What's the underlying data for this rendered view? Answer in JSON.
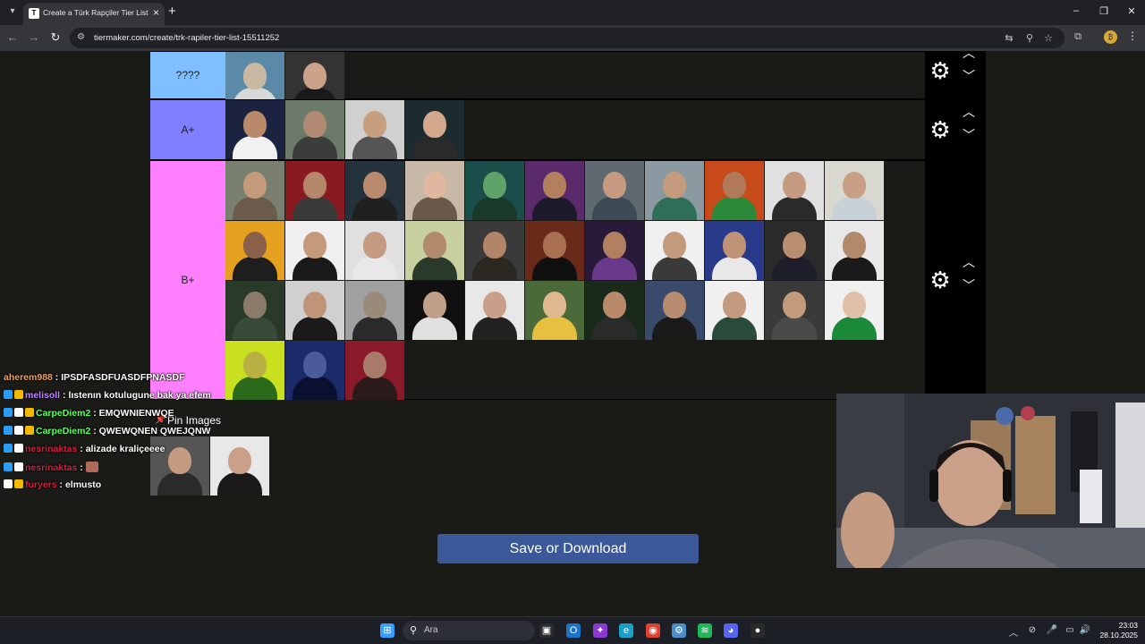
{
  "browser": {
    "tab_title": "Create a Türk Rapçiler Tier List",
    "url": "tiermaker.com/create/trk-rapiler-tier-list-15511252",
    "new_tab_label": "+",
    "close_tab_label": "×"
  },
  "tiers": [
    {
      "label": "????",
      "color": "#80bfff",
      "thumbs": [
        [
          "#5a8aa8",
          "#c9b9a2",
          "#d8d8d8"
        ],
        [
          "#333",
          "#caa28a",
          "#1a1a1a"
        ]
      ]
    },
    {
      "label": "A+",
      "color": "#7f7fff",
      "thumbs": [
        [
          "#1b2340",
          "#b88a6a",
          "#f1f1f1"
        ],
        [
          "#6c7a6a",
          "#b08a72",
          "#3a3d3a"
        ],
        [
          "#d0d0d0",
          "#c6a07e",
          "#555"
        ],
        [
          "#1c2b30",
          "#d4a88c",
          "#2a2a2a"
        ]
      ]
    },
    {
      "label": "B+",
      "color": "#ff7fff",
      "thumbs": [
        [
          "#7a8070",
          "#c39a7a",
          "#6b5b4a"
        ],
        [
          "#8a1a22",
          "#b4876a",
          "#3a3a3a"
        ],
        [
          "#24323c",
          "#b98a6e",
          "#202020"
        ],
        [
          "#c8b8a8",
          "#e0b8a0",
          "#6a5a4a"
        ],
        [
          "#1b4d4a",
          "#5fa36a",
          "#1a3a2a"
        ],
        [
          "#5a2a6a",
          "#b2805e",
          "#1c1a2a"
        ],
        [
          "#5e6a70",
          "#c59a80",
          "#3b4a55"
        ],
        [
          "#8a9aa0",
          "#c49a7c",
          "#2f6f5a"
        ],
        [
          "#c74a1a",
          "#b07a5a",
          "#2a8a3a"
        ],
        [
          "#e0e0e0",
          "#c49a80",
          "#2a2a2a"
        ],
        [
          "#d8d8d0",
          "#c9a085",
          "#c8d0d8"
        ],
        [
          "#e6a020",
          "#8a6048",
          "#1e1e1e"
        ],
        [
          "#f0f0f0",
          "#c49a7a",
          "#1a1a1a"
        ],
        [
          "#e0e0e0",
          "#c59a82",
          "#e8e8e8"
        ],
        [
          "#c8d0a0",
          "#b08a6a",
          "#2a3a2a"
        ],
        [
          "#3a3a3a",
          "#b28468",
          "#2a2820"
        ],
        [
          "#6a2a1a",
          "#a87050",
          "#101010"
        ],
        [
          "#2a1a3a",
          "#b08060",
          "#6a3a8a"
        ],
        [
          "#f0f0f0",
          "#c49a7c",
          "#3a3a3a"
        ],
        [
          "#2a3a8a",
          "#c09276",
          "#e8e8e8"
        ],
        [
          "#2a2a2a",
          "#b98e70",
          "#1e1e2a"
        ],
        [
          "#e8e8e8",
          "#b08a6a",
          "#1a1a1a"
        ],
        [
          "#2a3a2a",
          "#8a7a6a",
          "#3a4a3a"
        ],
        [
          "#d0d0d0",
          "#c09478",
          "#1a1a1a"
        ],
        [
          "#a0a0a0",
          "#9a8a7a",
          "#2a2a2a"
        ],
        [
          "#101010",
          "#c0a088",
          "#e0e0e0"
        ],
        [
          "#e8e8e8",
          "#c8a08a",
          "#222"
        ],
        [
          "#4a6a3a",
          "#e0b890",
          "#e8c040"
        ],
        [
          "#1a2a1a",
          "#b88a6a",
          "#2a2a2a"
        ],
        [
          "#3a4a6a",
          "#b88c70",
          "#1a1a1a"
        ],
        [
          "#f0f0f0",
          "#c49a7e",
          "#2a4a3a"
        ],
        [
          "#3a3a3a",
          "#c29a7c",
          "#4a4a4a"
        ],
        [
          "#f0f0f0",
          "#e0c0a8",
          "#1a8a3a"
        ],
        [
          "#c8e020",
          "#b8b040",
          "#2a6a1a"
        ],
        [
          "#1a2a6a",
          "#4a5a9a",
          "#0a1030"
        ],
        [
          "#8a1a2a",
          "#a87a6a",
          "#2a1a1a"
        ]
      ]
    }
  ],
  "pin": {
    "label": "Pin Images",
    "thumbs": [
      [
        "#555",
        "#c49a80",
        "#2a2a2a"
      ],
      [
        "#e8e8e8",
        "#caa088",
        "#1a1a1a"
      ]
    ]
  },
  "save_button": "Save or Download",
  "chat": [
    {
      "user": "aherem988",
      "user_color": "#e8a060",
      "message": "IPSDFASDFUASDFPNASDF",
      "badges": []
    },
    {
      "user": "melisoll",
      "user_color": "#c080ff",
      "message": "lıstenın kotulugune bak ya efem",
      "badges": [
        "#2a9df4",
        "#f5b800"
      ]
    },
    {
      "user": "CarpeDiem2",
      "user_color": "#60ff60",
      "message": "EMQWNIENWQE",
      "badges": [
        "#2a9df4",
        "#ffffff",
        "#f5b800"
      ]
    },
    {
      "user": "CarpeDiem2",
      "user_color": "#60ff60",
      "message": "QWEWQNEN QWEJQNW",
      "badges": [
        "#2a9df4",
        "#ffffff",
        "#f5b800"
      ]
    },
    {
      "user": "nesrinaktas",
      "user_color": "#d02040",
      "message": "alizade kraliçeeee",
      "badges": [
        "#2a9df4",
        "#ffffff"
      ]
    },
    {
      "user": "nesrinaktas",
      "user_color": "#d02040",
      "message": "",
      "badges": [
        "#2a9df4",
        "#ffffff"
      ]
    },
    {
      "user": "furyers",
      "user_color": "#d02040",
      "message": "elmusto",
      "badges": [
        "#ffffff",
        "#f5b800"
      ]
    }
  ],
  "chat_separator": ":",
  "taskbar": {
    "search_placeholder": "Ara",
    "time": "23:03",
    "date": "28.10.2025"
  }
}
